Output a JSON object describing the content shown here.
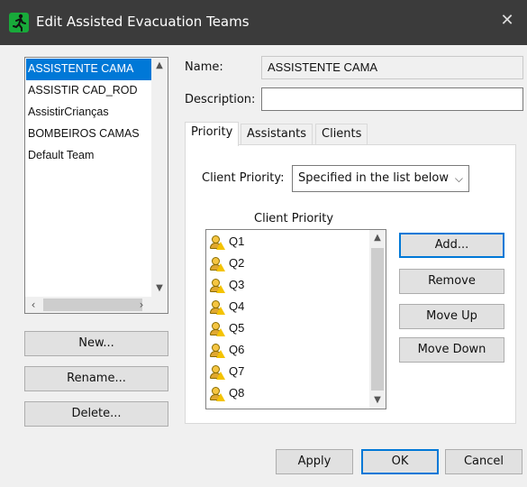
{
  "window": {
    "title": "Edit Assisted Evacuation Teams",
    "close_glyph": "✕"
  },
  "teams": {
    "items": [
      "ASSISTENTE CAMA",
      "ASSISTIR CAD_ROD",
      "AssistirCrianças",
      "BOMBEIROS CAMAS",
      "Default Team"
    ],
    "selected_index": 0
  },
  "left_buttons": {
    "new": "New...",
    "rename": "Rename...",
    "delete": "Delete..."
  },
  "form": {
    "name_label": "Name:",
    "name_value": "ASSISTENTE CAMA",
    "description_label": "Description:",
    "description_value": ""
  },
  "tabs": [
    "Priority",
    "Assistants",
    "Clients"
  ],
  "active_tab": "Priority",
  "priority": {
    "client_priority_label": "Client Priority:",
    "client_priority_value": "Specified in the list below",
    "list_header": "Client Priority",
    "clients": [
      "Q1",
      "Q2",
      "Q3",
      "Q4",
      "Q5",
      "Q6",
      "Q7",
      "Q8"
    ],
    "client_icon": "person-warning-icon",
    "buttons": {
      "add": "Add...",
      "remove": "Remove",
      "move_up": "Move Up",
      "move_down": "Move Down"
    }
  },
  "footer": {
    "apply": "Apply",
    "ok": "OK",
    "cancel": "Cancel"
  },
  "colors": {
    "titlebar": "#3b3b3b",
    "selection": "#0078d7",
    "app_icon": "#18aa3a"
  }
}
